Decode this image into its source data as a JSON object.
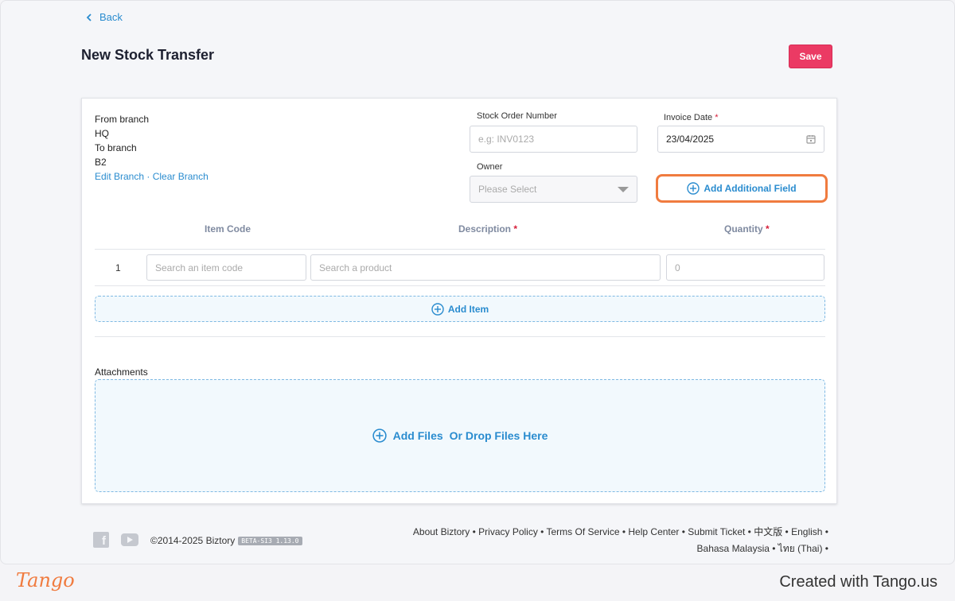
{
  "nav": {
    "back_label": "Back"
  },
  "page": {
    "title": "New Stock Transfer",
    "save_label": "Save"
  },
  "branch": {
    "from_label": "From branch",
    "from_value": "HQ",
    "to_label": "To branch",
    "to_value": "B2",
    "edit_label": "Edit Branch",
    "separator": " · ",
    "clear_label": "Clear Branch"
  },
  "stock_order": {
    "label": "Stock Order Number",
    "placeholder": "e.g: INV0123"
  },
  "invoice_date": {
    "label": "Invoice Date",
    "required": "*",
    "value": "23/04/2025"
  },
  "owner": {
    "label": "Owner",
    "placeholder": "Please Select"
  },
  "add_additional_field_label": "Add Additional Field",
  "items_table": {
    "headers": {
      "item_code": "Item Code",
      "description": "Description",
      "quantity": "Quantity",
      "required": "*"
    },
    "rows": [
      {
        "index": "1",
        "item_code_placeholder": "Search an item code",
        "product_placeholder": "Search a product",
        "quantity_placeholder": "0"
      }
    ],
    "add_item_label": "Add Item"
  },
  "attachments": {
    "label": "Attachments",
    "add_files_label": "Add Files",
    "drop_label": "Or Drop Files Here"
  },
  "footer": {
    "copyright": "©2014-2025 Biztory",
    "version_badge": "BETA-SI3 1.13.0",
    "links_line1": [
      "About Biztory",
      "Privacy Policy",
      "Terms Of Service",
      "Help Center",
      "Submit Ticket",
      "中文版",
      "English"
    ],
    "links_line2": [
      "Bahasa Malaysia",
      "ไทย (Thai)"
    ],
    "bullet": " • "
  },
  "tango": {
    "logo": "Tango",
    "credit": "Created with Tango.us"
  },
  "colors": {
    "accent_blue": "#2a8ccf",
    "save_red": "#eb3a64",
    "highlight_orange": "#f07b3f"
  }
}
